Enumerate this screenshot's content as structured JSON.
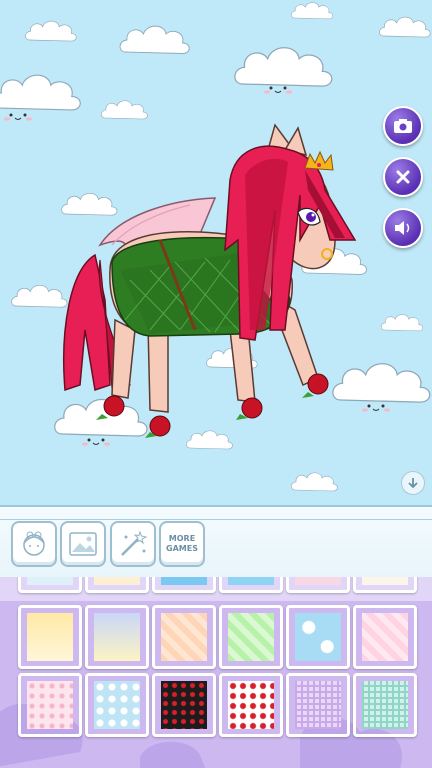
{
  "toolbar": {
    "tools": [
      {
        "name": "character-tool",
        "icon": "girl-face-icon"
      },
      {
        "name": "background-tool",
        "icon": "picture-icon"
      },
      {
        "name": "effects-tool",
        "icon": "magic-wand-icon"
      },
      {
        "name": "more-games-tool",
        "label_line1": "MORE",
        "label_line2": "GAMES"
      }
    ]
  },
  "side_buttons": [
    {
      "name": "camera-button",
      "icon": "camera-icon"
    },
    {
      "name": "close-button",
      "icon": "close-icon"
    },
    {
      "name": "sound-button",
      "icon": "speaker-icon"
    }
  ],
  "background_options": {
    "selected": null,
    "patterns": [
      "light-yellow-fade",
      "blue-gradient",
      "peach-hearts",
      "green-hearts",
      "sky-clouds",
      "pink-hearts",
      "pink-flowers",
      "light-blue-clouds",
      "black-red-hearts",
      "white-red-hearts",
      "lavender-plaid",
      "mint-plaid"
    ]
  },
  "colors": {
    "sky": "#bfe8f8",
    "panel": "#cdb8ef",
    "accent_button": "#6b3fc4",
    "pony_mane": "#e81f54",
    "pony_body": "#f7cbb9",
    "pony_coat": "#2f7d23"
  }
}
